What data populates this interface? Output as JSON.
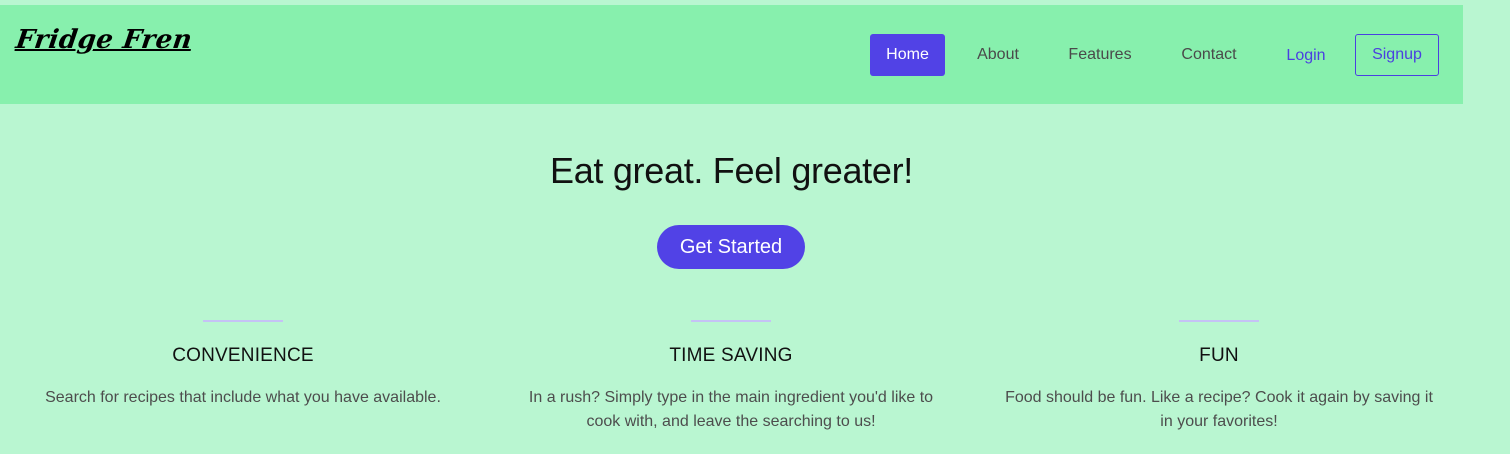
{
  "brand": "Fridge Fren",
  "nav": {
    "home": "Home",
    "about": "About",
    "features": "Features",
    "contact": "Contact",
    "login": "Login",
    "signup": "Signup"
  },
  "hero": {
    "title": "Eat great. Feel greater!",
    "cta": "Get Started"
  },
  "features": [
    {
      "title": "CONVENIENCE",
      "description": "Search for recipes that include what you have available."
    },
    {
      "title": "TIME SAVING",
      "description": "In a rush? Simply type in the main ingredient you'd like to cook with, and leave the searching to us!"
    },
    {
      "title": "FUN",
      "description": "Food should be fun. Like a recipe? Cook it again by saving it in your favorites!"
    }
  ],
  "colors": {
    "page_background": "#b9f6d1",
    "navbar_background": "#87f0ad",
    "accent": "#5142e6"
  }
}
